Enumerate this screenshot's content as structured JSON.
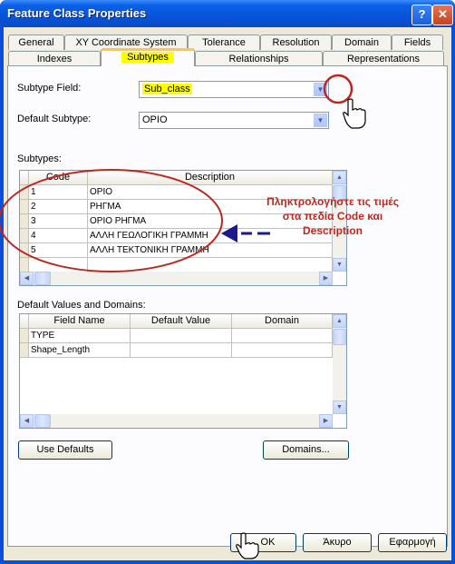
{
  "window": {
    "title": "Feature Class Properties",
    "help_glyph": "?",
    "close_glyph": "✕"
  },
  "tabs": {
    "row1": [
      "General",
      "XY Coordinate System",
      "Tolerance",
      "Resolution",
      "Domain",
      "Fields"
    ],
    "row2": [
      "Indexes",
      "Subtypes",
      "Relationships",
      "Representations"
    ],
    "active": "Subtypes"
  },
  "subtype_field": {
    "label": "Subtype Field:",
    "value": "Sub_class"
  },
  "default_subtype": {
    "label": "Default Subtype:",
    "value": "ΟΡΙΟ"
  },
  "subtypes": {
    "label": "Subtypes:",
    "columns": [
      "Code",
      "Description"
    ],
    "rows": [
      {
        "code": "1",
        "description": "ΟΡΙΟ"
      },
      {
        "code": "2",
        "description": "ΡΗΓΜΑ"
      },
      {
        "code": "3",
        "description": "ΟΡΙΟ ΡΗΓΜΑ"
      },
      {
        "code": "4",
        "description": "ΑΛΛΗ ΓΕΩΛΟΓΙΚΗ ΓΡΑΜΜΗ"
      },
      {
        "code": "5",
        "description": "ΑΛΛΗ ΤΕΚΤΟΝΙΚΗ ΓΡΑΜΜΗ"
      }
    ]
  },
  "defaults": {
    "label": "Default Values and Domains:",
    "columns": [
      "Field Name",
      "Default Value",
      "Domain"
    ],
    "rows": [
      {
        "field": "TYPE",
        "default": "",
        "domain": ""
      },
      {
        "field": "Shape_Length",
        "default": "",
        "domain": ""
      }
    ]
  },
  "buttons": {
    "use_defaults": "Use Defaults",
    "domains": "Domains...",
    "ok": "OK",
    "cancel": "Άκυρο",
    "apply": "Εφαρμογή"
  },
  "annotation": {
    "line1": "Πληκτρολογήστε τις τιμές",
    "line2": "στα πεδία Code και",
    "line3": "Description",
    "color": "#c0261e",
    "arrow_color": "#1a1a8c"
  },
  "colors": {
    "title_bar": "#0754d9",
    "dialog_bg": "#ece9d8",
    "highlight": "#ffff00"
  }
}
